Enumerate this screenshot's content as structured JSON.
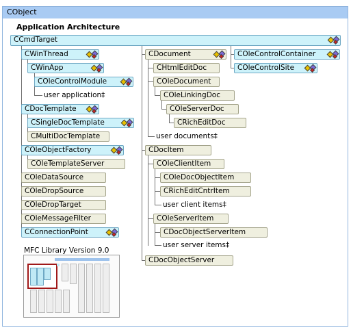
{
  "root_label": "CObject",
  "section_title": "Application Architecture",
  "ccmdtarget": "CCmdTarget",
  "left_column": {
    "cwinthread": "CWinThread",
    "cwinapp": "CWinApp",
    "colecontrolmodule": "COleControlModule",
    "user_application": "user application‡",
    "cdoctemplate": "CDocTemplate",
    "csingledoctemplate": "CSingleDocTemplate",
    "cmultidoctemplate": "CMultiDocTemplate",
    "coleobjectfactory": "COleObjectFactory",
    "coletemplateserver": "COleTemplateServer",
    "coledatasource": "COleDataSource",
    "coledropsource": "COleDropSource",
    "coledroptarget": "COleDropTarget",
    "colemessagefilter": "COleMessageFilter",
    "cconnectionpoint": "CConnectionPoint"
  },
  "middle_column": {
    "cdocument": "CDocument",
    "chtmleditdoc": "CHtmlEditDoc",
    "coledocument": "COleDocument",
    "colelinkingdoc": "COleLinkingDoc",
    "coleserverdoc": "COleServerDoc",
    "cricheditdoc": "CRichEditDoc",
    "user_documents": "user documents‡",
    "cdocitem": "CDocItem",
    "coleclientitem": "COleClientItem",
    "coledocobjectitem": "COleDocObjectItem",
    "cricheditcntritem": "CRichEditCntrItem",
    "user_client_items": "user client items‡",
    "coleserveritem": "COleServerItem",
    "cdocobjectserveritem": "CDocObjectServerItem",
    "user_server_items": "user server items‡",
    "cdocobjectserver": "CDocObjectServer"
  },
  "right_column": {
    "colecontrolcontainer": "COleControlContainer",
    "colecontrolsite": "COleControlSite"
  },
  "library_version": "MFC Library Version 9.0",
  "colors": {
    "header": "#a9cbf3",
    "cyan_box": "#cdf2fa",
    "beige_box": "#efefdf",
    "frame": "#8fb4de",
    "highlight": "#a01818"
  },
  "icon_names": {
    "class_icon": "serializable-dynamic-icon"
  }
}
